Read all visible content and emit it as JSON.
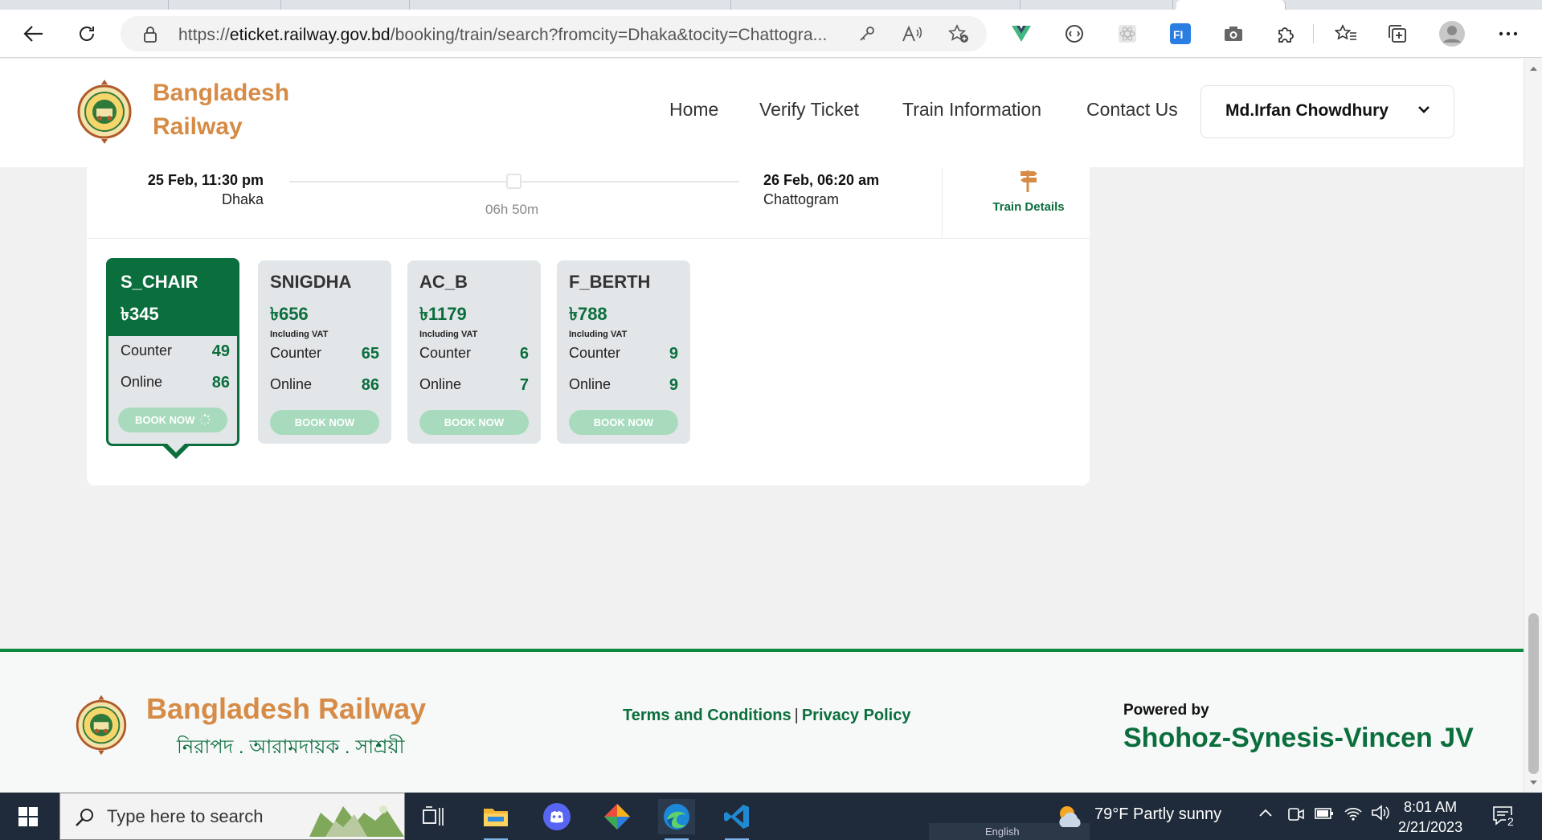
{
  "browser": {
    "url_prefix": "https://",
    "url_host": "eticket.railway.gov.bd",
    "url_rest": "/booking/train/search?fromcity=Dhaka&tocity=Chattogra..."
  },
  "header": {
    "brand_line1": "Bangladesh",
    "brand_line2": "Railway",
    "nav": [
      "Home",
      "Verify Ticket",
      "Train Information",
      "Contact Us"
    ],
    "user_name": "Md.Irfan Chowdhury"
  },
  "journey": {
    "departure_time": "25 Feb, 11:30 pm",
    "departure_city": "Dhaka",
    "duration": "06h 50m",
    "arrival_time": "26 Feb, 06:20 am",
    "arrival_city": "Chattogram",
    "train_details_label": "Train Details"
  },
  "seats": [
    {
      "class": "S_CHAIR",
      "price": "৳345",
      "vat": "",
      "counter_label": "Counter",
      "counter": "49",
      "online_label": "Online",
      "online": "86",
      "button": "BOOK NOW",
      "selected": true
    },
    {
      "class": "SNIGDHA",
      "price": "৳656",
      "vat": "Including VAT",
      "counter_label": "Counter",
      "counter": "65",
      "online_label": "Online",
      "online": "86",
      "button": "BOOK NOW",
      "selected": false
    },
    {
      "class": "AC_B",
      "price": "৳1179",
      "vat": "Including VAT",
      "counter_label": "Counter",
      "counter": "6",
      "online_label": "Online",
      "online": "7",
      "button": "BOOK NOW",
      "selected": false
    },
    {
      "class": "F_BERTH",
      "price": "৳788",
      "vat": "Including VAT",
      "counter_label": "Counter",
      "counter": "9",
      "online_label": "Online",
      "online": "9",
      "button": "BOOK NOW",
      "selected": false
    }
  ],
  "footer": {
    "brand": "Bangladesh Railway",
    "tagline": "নিরাপদ . আরামদায়ক . সাশ্রয়ী",
    "terms": "Terms and Conditions",
    "separator": "|",
    "privacy": "Privacy Policy",
    "powered_by": "Powered by",
    "vendor": "Shohoz-Synesis-Vincen JV"
  },
  "taskbar": {
    "search_placeholder": "Type here to search",
    "weather": "79°F  Partly sunny",
    "time": "8:01 AM",
    "date": "2/21/2023",
    "notification_count": "2",
    "language": "English"
  },
  "colors": {
    "brand_green": "#0b6e3d",
    "brand_orange": "#d68b46",
    "book_button": "#a8dbbd"
  }
}
